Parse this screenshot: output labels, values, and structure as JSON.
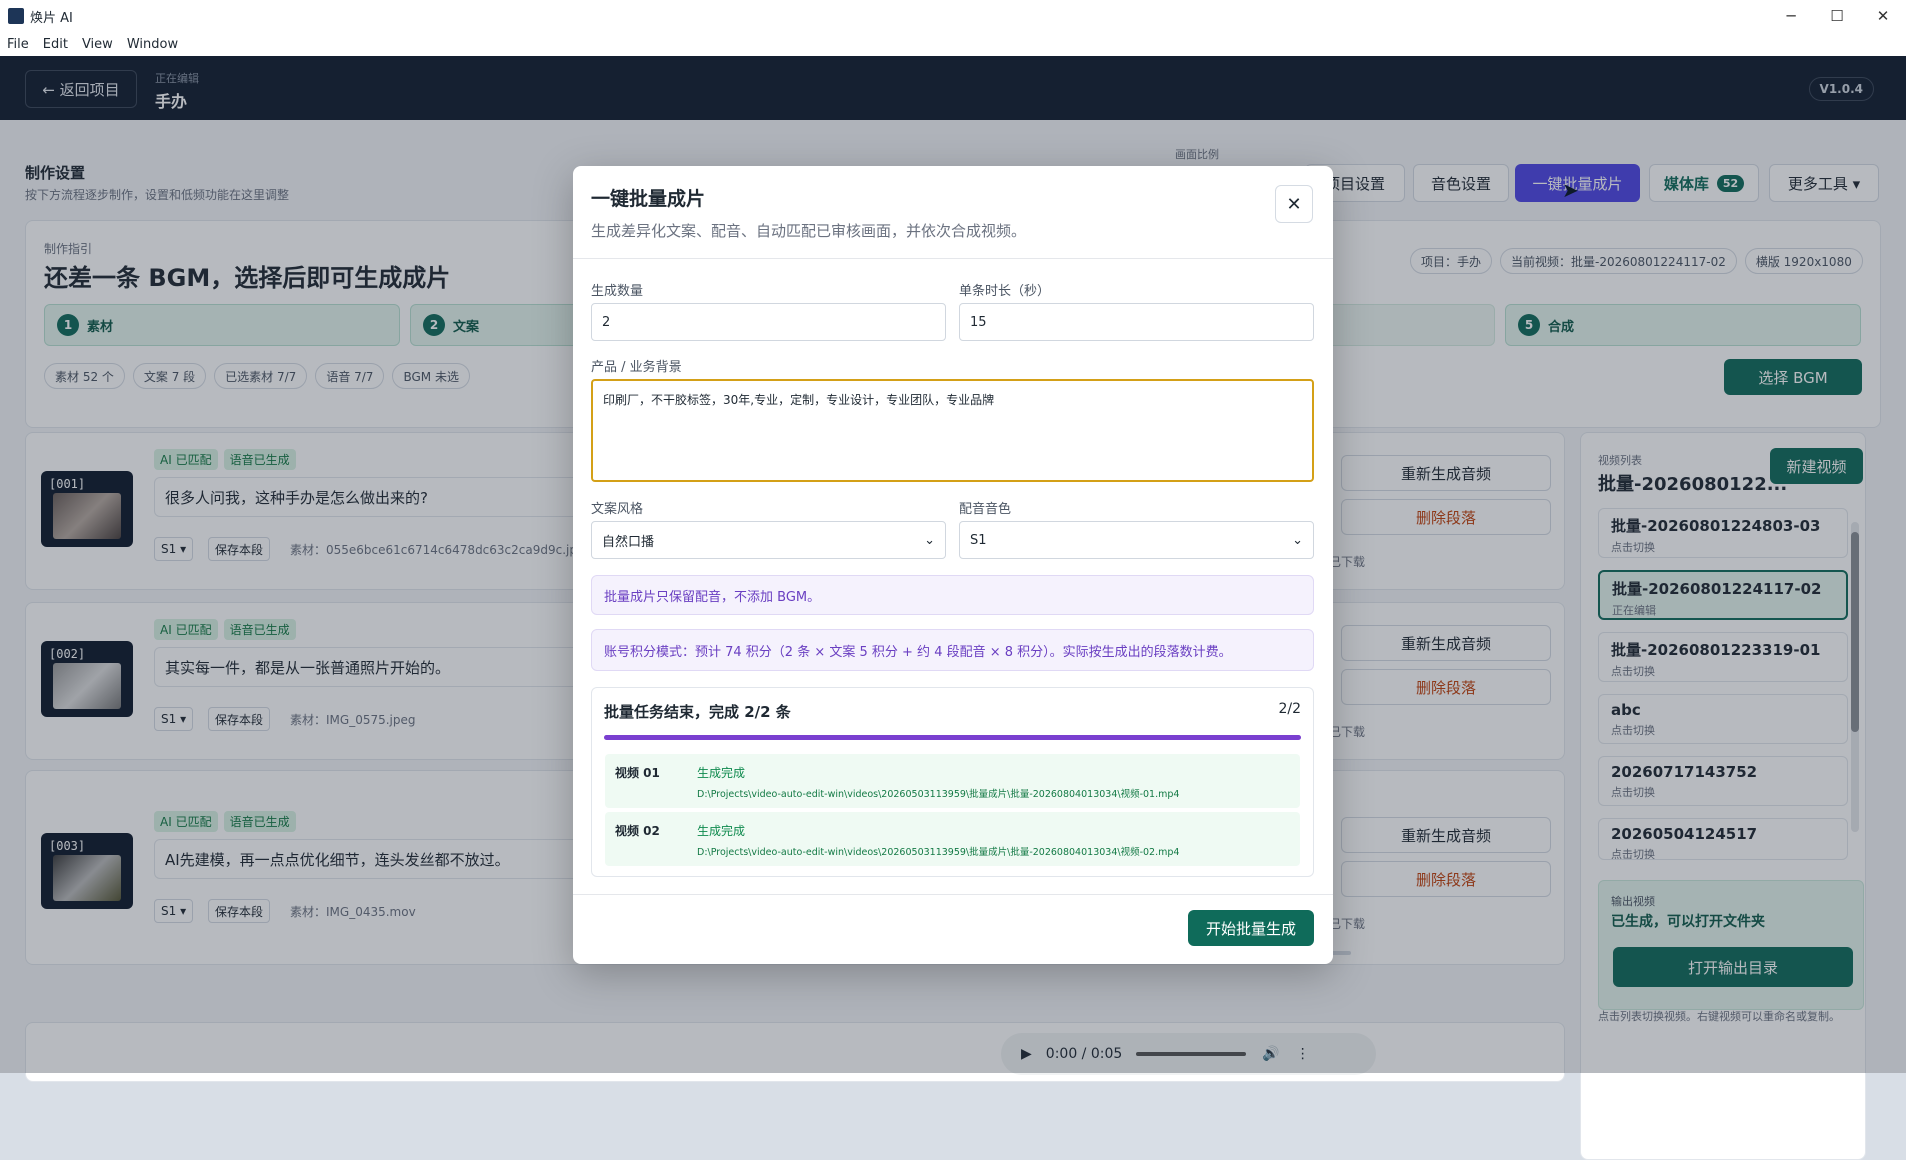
{
  "window": {
    "app_title": "焕片 AI",
    "minimize": "─",
    "maximize": "☐",
    "close": "✕"
  },
  "menu": [
    "File",
    "Edit",
    "View",
    "Window"
  ],
  "header": {
    "back": "← 返回项目",
    "editing_label": "正在编辑",
    "project_name": "手办",
    "version": "V1.0.4"
  },
  "settings": {
    "title": "制作设置",
    "subtitle": "按下方流程逐步制作，设置和低频功能在这里调整"
  },
  "ratio_label": "画面比例",
  "toolbar": {
    "project_settings": "项目设置",
    "voice_settings": "音色设置",
    "batch": "一键批量成片",
    "media_library": "媒体库",
    "media_count": "52",
    "more_tools": "更多工具 ▾"
  },
  "guide": {
    "label": "制作指引",
    "heading": "还差一条 BGM，选择后即可生成成片",
    "info_chips": [
      "项目：手办",
      "当前视频：批量-20260801224117-02",
      "横版 1920x1080"
    ],
    "steps": [
      {
        "num": "1",
        "label": "素材"
      },
      {
        "num": "2",
        "label": "文案"
      },
      {
        "num": "5",
        "label": "合成"
      }
    ],
    "stat_chips": [
      "素材 52 个",
      "文案 7 段",
      "已选素材 7/7",
      "语音 7/7",
      "BGM 未选"
    ],
    "select_bgm": "选择 BGM"
  },
  "segments": [
    {
      "id": "[001]",
      "tags": [
        "AI 已匹配",
        "语音已生成"
      ],
      "text": "很多人问我，这种手办是怎么做出来的?",
      "voice": "S1 ▾",
      "save": "保存本段",
      "material": "素材：055e6bce61c6714c6478dc63c2ca9d9c.jpg",
      "regen": "重新生成音频",
      "delete": "删除段落",
      "downloaded": "已下载"
    },
    {
      "id": "[002]",
      "tags": [
        "AI 已匹配",
        "语音已生成"
      ],
      "text": "其实每一件，都是从一张普通照片开始的。",
      "voice": "S1 ▾",
      "save": "保存本段",
      "material": "素材：IMG_0575.jpeg",
      "regen": "重新生成音频",
      "delete": "删除段落",
      "downloaded": "已下载"
    },
    {
      "id": "[003]",
      "tags": [
        "AI 已匹配",
        "语音已生成"
      ],
      "text": "AI先建模，再一点点优化细节，连头发丝都不放过。",
      "voice": "S1 ▾",
      "save": "保存本段",
      "material": "素材：IMG_0435.mov",
      "regen": "重新生成音频",
      "delete": "删除段落",
      "downloaded": "已下载"
    }
  ],
  "videos": {
    "label": "视频列表",
    "current": "批量-2026080122...",
    "new_video": "新建视频",
    "items": [
      {
        "name": "批量-20260801224803-03",
        "status": "点击切换"
      },
      {
        "name": "批量-20260801224117-02",
        "status": "正在编辑"
      },
      {
        "name": "批量-20260801223319-01",
        "status": "点击切换"
      },
      {
        "name": "abc",
        "status": "点击切换"
      },
      {
        "name": "20260717143752",
        "status": "点击切换"
      },
      {
        "name": "20260504124517",
        "status": "点击切换"
      }
    ],
    "output_label": "输出视频",
    "output_status": "已生成，可以打开文件夹",
    "open_output": "打开输出目录",
    "hint": "点击列表切换视频。右键视频可以重命名或复制。"
  },
  "player": {
    "time": "0:00 / 0:05",
    "progress": 0.0,
    "upper_slider": 0.11
  },
  "modal": {
    "title": "一键批量成片",
    "subtitle": "生成差异化文案、配音、自动匹配已审核画面，并依次合成视频。",
    "count_label": "生成数量",
    "count_value": "2",
    "duration_label": "单条时长（秒）",
    "duration_value": "15",
    "bg_label": "产品 / 业务背景",
    "bg_value": "印刷厂，不干胶标签，30年,专业，定制，专业设计，专业团队，专业品牌",
    "style_label": "文案风格",
    "style_value": "自然口播",
    "voice_label": "配音音色",
    "voice_value": "S1",
    "note1": "批量成片只保留配音，不添加 BGM。",
    "note2": "账号积分模式：预计 74 积分（2 条 × 文案 5 积分 + 约 4 段配音 × 8 积分）。实际按生成出的段落数计费。",
    "task_title": "批量任务结束，完成 2/2 条",
    "task_count": "2/2",
    "progress": 1.0,
    "tasks": [
      {
        "name": "视频 01",
        "status": "生成完成",
        "path": "D:\\Projects\\video-auto-edit-win\\videos\\20260503113959\\批量成片\\批量-20260804013034\\视频-01.mp4"
      },
      {
        "name": "视频 02",
        "status": "生成完成",
        "path": "D:\\Projects\\video-auto-edit-win\\videos\\20260503113959\\批量成片\\批量-20260804013034\\视频-02.mp4"
      }
    ],
    "start": "开始批量生成",
    "close": "✕"
  },
  "colors": {
    "accent": "#0f6b5a",
    "batch_active": "#4f46e5",
    "header_bg": "#111c2e",
    "progress": "#7a3fd0"
  }
}
